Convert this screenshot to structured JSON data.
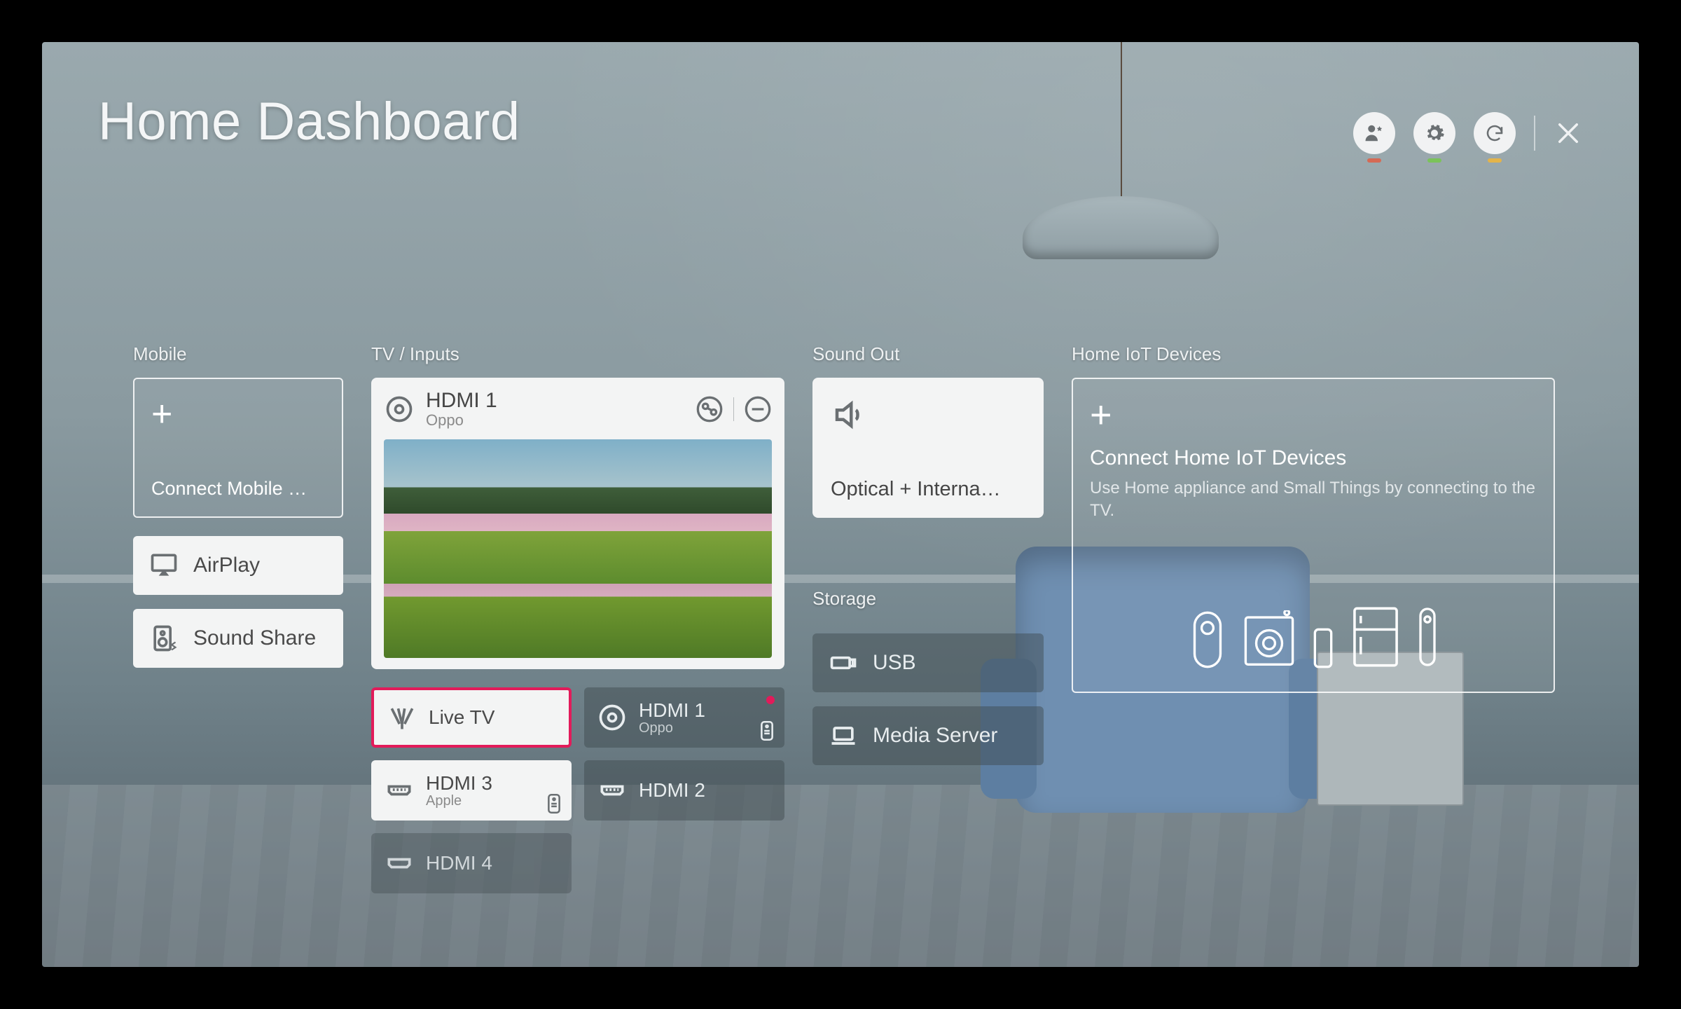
{
  "header": {
    "title": "Home Dashboard",
    "action_status_colors": [
      "#d56a55",
      "#7bc35a",
      "#e4b44a"
    ]
  },
  "columns": {
    "mobile": {
      "label": "Mobile",
      "connect_label": "Connect Mobile …",
      "items": [
        {
          "label": "AirPlay"
        },
        {
          "label": "Sound Share"
        }
      ]
    },
    "tv": {
      "label": "TV / Inputs",
      "current": {
        "title": "HDMI 1",
        "subtitle": "Oppo"
      },
      "tiles": [
        {
          "title": "Live TV",
          "subtitle": "",
          "style": "white",
          "selected": true
        },
        {
          "title": "HDMI 1",
          "subtitle": "Oppo",
          "style": "gray",
          "active": true,
          "badge": true
        },
        {
          "title": "HDMI 3",
          "subtitle": "Apple",
          "style": "white",
          "badge": true
        },
        {
          "title": "HDMI 2",
          "subtitle": "",
          "style": "gray"
        },
        {
          "title": "HDMI 4",
          "subtitle": "",
          "style": "gray",
          "partial": true
        }
      ]
    },
    "sound": {
      "label": "Sound Out",
      "output_label": "Optical + Interna…"
    },
    "storage": {
      "label": "Storage",
      "items": [
        {
          "label": "USB"
        },
        {
          "label": "Media Server"
        }
      ]
    },
    "iot": {
      "label": "Home IoT Devices",
      "title": "Connect Home IoT Devices",
      "description": "Use Home appliance and Small Things by connecting to the TV."
    }
  }
}
